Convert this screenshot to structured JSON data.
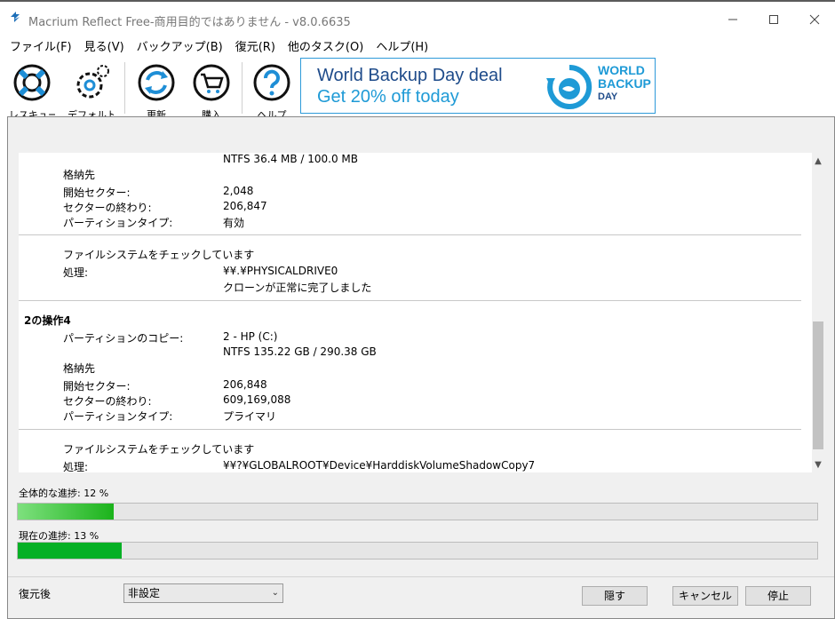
{
  "window": {
    "title": "Macrium Reflect Free-商用目的ではありません - v8.0.6635"
  },
  "menu": [
    "ファイル(F)",
    "見る(V)",
    "バックアップ(B)",
    "復元(R)",
    "他のタスク(O)",
    "ヘルプ(H)"
  ],
  "toolbar": {
    "rescue_label": "レスキュー",
    "defaults_label": "デフォルト",
    "update_label": "更新",
    "buy_label": "購入",
    "help_label": "ヘルプ"
  },
  "banner": {
    "line1": "World Backup Day deal",
    "line2": "Get 20% off today",
    "brand1": "WORLD",
    "brand2": "BACKUP",
    "brand3": "DAY"
  },
  "log": {
    "op3": {
      "fs": "NTFS 36.4 MB / 100.0 MB",
      "dest_label": "格納先",
      "start_label": "開始セクター:",
      "start_val": "2,048",
      "end_label": "セクターの終わり:",
      "end_val": "206,847",
      "type_label": "パーティションタイプ:",
      "type_val": "有効",
      "check_label": "ファイルシステムをチェックしています",
      "proc_label": "処理:",
      "proc_val": "¥¥.¥PHYSICALDRIVE0",
      "proc_result": "クローンが正常に完了しました"
    },
    "op4": {
      "title": "2の操作4",
      "copy_label": "パーティションのコピー:",
      "copy_val": "2 - HP (C:)",
      "fs": "NTFS 135.22 GB / 290.38 GB",
      "dest_label": "格納先",
      "start_label": "開始セクター:",
      "start_val": "206,848",
      "end_label": "セクターの終わり:",
      "end_val": "609,169,088",
      "type_label": "パーティションタイプ:",
      "type_val": "プライマリ",
      "check_label": "ファイルシステムをチェックしています",
      "proc_label": "処理:",
      "proc_val": "¥¥?¥GLOBALROOT¥Device¥HarddiskVolumeShadowCopy7"
    }
  },
  "progress": {
    "overall_label": "全体的な進捗:  12 %",
    "overall_fraction": 0.12,
    "current_label": "現在の進捗:  13 %",
    "current_fraction": 0.13
  },
  "footer": {
    "after_label": "復元後",
    "after_value": "非設定",
    "hide_label": "隠す",
    "cancel_label": "キャンセル",
    "stop_label": "停止"
  },
  "colors": {
    "progress_green": "#06b025",
    "banner_blue": "#1e9ad6"
  }
}
